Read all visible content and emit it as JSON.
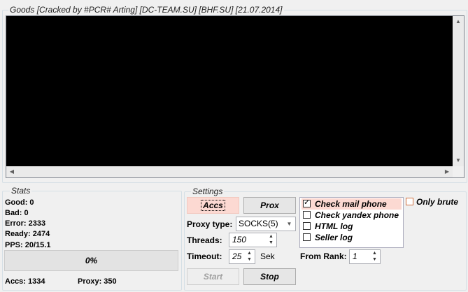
{
  "goods": {
    "title": "Goods [Cracked by #PCR# Arting] [DC-TEAM.SU] [BHF.SU] [21.07.2014]"
  },
  "stats": {
    "title": "Stats",
    "good": "Good: 0",
    "bad": "Bad: 0",
    "error": "Error: 2333",
    "ready": "Ready: 2474",
    "pps": "PPS: 20/15.1",
    "progress_label": "0%",
    "progress_value": 0,
    "accs": "Accs: 1334",
    "proxy": "Proxy: 350"
  },
  "settings": {
    "title": "Settings",
    "accs_button": "Accs",
    "prox_button": "Prox",
    "proxy_type_label": "Proxy type:",
    "proxy_type_value": "SOCKS(5)",
    "threads_label": "Threads:",
    "threads_value": "150",
    "timeout_label": "Timeout:",
    "timeout_value": "25",
    "timeout_unit": "Sek",
    "from_rank_label": "From Rank:",
    "from_rank_value": "1",
    "start_button": "Start",
    "stop_button": "Stop",
    "checks": [
      {
        "label": "Check mail phone",
        "checked": true
      },
      {
        "label": "Check yandex phone",
        "checked": false
      },
      {
        "label": "HTML log",
        "checked": false
      },
      {
        "label": "Seller log",
        "checked": false
      }
    ],
    "only_brute": {
      "label": "Only brute",
      "checked": false
    }
  },
  "colors": {
    "accent": "#fcd9d2",
    "log_bg": "#000000",
    "window_bg": "#f0f0f0"
  }
}
